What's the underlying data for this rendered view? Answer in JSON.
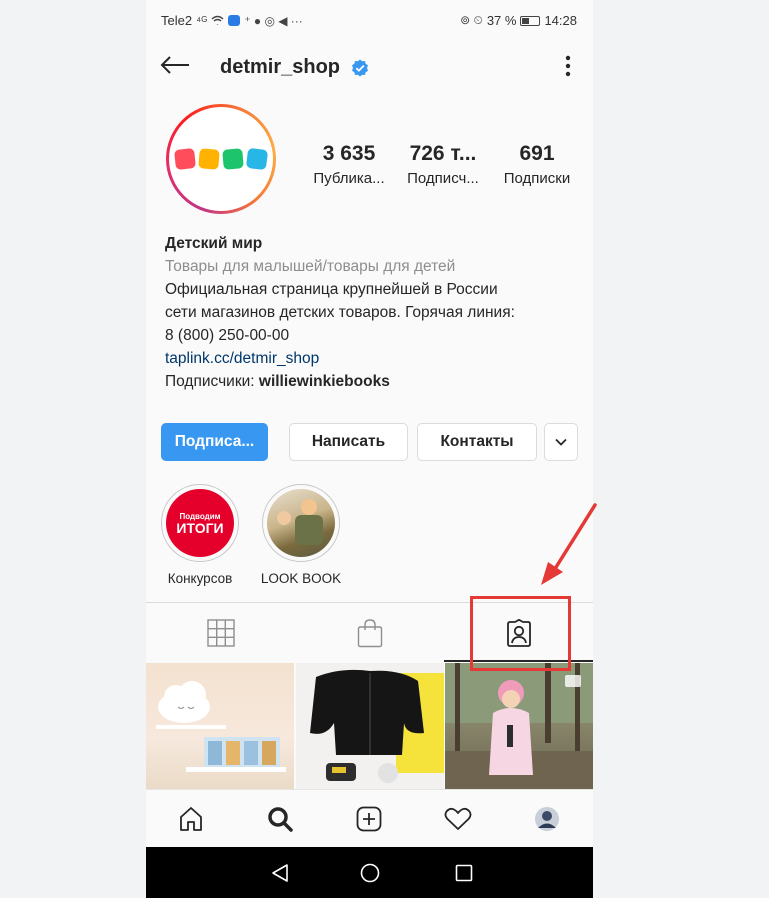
{
  "status_bar": {
    "carrier": "Tele2",
    "signal": "⁴ᴳ",
    "battery_percent": "37 %",
    "time": "14:28"
  },
  "header": {
    "username": "detmir_shop",
    "back_icon": "arrow-left-icon",
    "more_icon": "vertical-dots-icon",
    "verified_icon": "verified-badge-icon"
  },
  "profile": {
    "stats": [
      {
        "value": "3 635",
        "label": "Публика..."
      },
      {
        "value": "726 т...",
        "label": "Подписч..."
      },
      {
        "value": "691",
        "label": "Подписки"
      }
    ],
    "name": "Детский мир",
    "category": "Товары для малышей/товары для детей",
    "bio_line1": "Официальная страница крупнейшей в России",
    "bio_line2": "сети магазинов детских товаров. Горячая линия:",
    "bio_line3": "8 (800) 250-00-00",
    "link": "taplink.cc/detmir_shop",
    "followers_prefix": "Подписчики: ",
    "followers_name": "williewinkiebooks",
    "logo_colors": [
      "#ff4d5c",
      "#ffb300",
      "#1ec46c",
      "#27b6e6"
    ]
  },
  "buttons": {
    "follow": "Подписа...",
    "message": "Написать",
    "contacts": "Контакты",
    "dropdown_icon": "chevron-down-icon"
  },
  "highlights": [
    {
      "label": "Конкурсов",
      "badge_small": "Подводим",
      "badge_big": "ИТОГИ"
    },
    {
      "label": "LOOK BOOK"
    }
  ],
  "tabs": [
    {
      "icon": "grid-icon"
    },
    {
      "icon": "shopping-bag-icon"
    },
    {
      "icon": "tagged-user-icon"
    }
  ],
  "bottom_nav": [
    {
      "icon": "home-icon"
    },
    {
      "icon": "search-icon"
    },
    {
      "icon": "new-post-icon"
    },
    {
      "icon": "heart-icon"
    },
    {
      "icon": "profile-avatar-icon"
    }
  ],
  "system_nav": [
    {
      "icon": "back-triangle-icon"
    },
    {
      "icon": "home-circle-icon"
    },
    {
      "icon": "recents-square-icon"
    }
  ],
  "annotation": {
    "highlight_color": "#e53935"
  }
}
